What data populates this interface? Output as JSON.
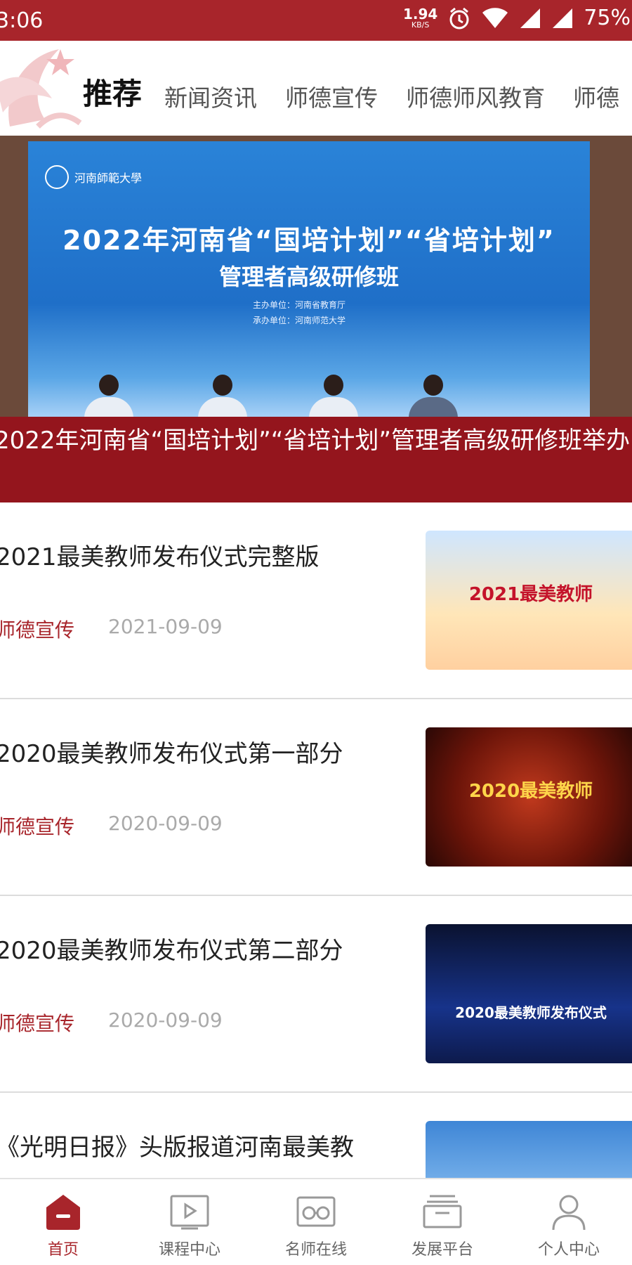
{
  "status": {
    "time": "3:06",
    "net_speed": "1.94",
    "net_unit": "KB/S",
    "battery": "75%"
  },
  "header": {
    "tabs": [
      "推荐",
      "新闻资讯",
      "师德宣传",
      "师德师风教育",
      "师德"
    ]
  },
  "banner": {
    "university": "河南師範大學",
    "screen_line1": "2022年河南省“国培计划”“省培计划”",
    "screen_line2": "管理者高级研修班",
    "screen_host1": "主办单位：河南省教育厅",
    "screen_host2": "承办单位：河南师范大学",
    "caption": "2022年河南省“国培计划”“省培计划”管理者高级研修班举办"
  },
  "articles": [
    {
      "title": "2021最美教师发布仪式完整版",
      "category": "师德宣传",
      "date": "2021-09-09",
      "thumb_text": "2021最美教师"
    },
    {
      "title": "2020最美教师发布仪式第一部分",
      "category": "师德宣传",
      "date": "2020-09-09",
      "thumb_text": "2020最美教师"
    },
    {
      "title": "2020最美教师发布仪式第二部分",
      "category": "师德宣传",
      "date": "2020-09-09",
      "thumb_text": "2020最美教师发布仪式"
    },
    {
      "title": "《光明日报》头版报道河南最美教",
      "category": "",
      "date": "",
      "thumb_text": ""
    }
  ],
  "bottom_nav": [
    {
      "label": "首页",
      "icon": "home-icon"
    },
    {
      "label": "课程中心",
      "icon": "video-play-icon"
    },
    {
      "label": "名师在线",
      "icon": "glasses-icon"
    },
    {
      "label": "发展平台",
      "icon": "stack-icon"
    },
    {
      "label": "个人中心",
      "icon": "person-icon"
    }
  ],
  "colors": {
    "brand_red": "#a8252b",
    "muted_text": "#aaaaaa"
  }
}
